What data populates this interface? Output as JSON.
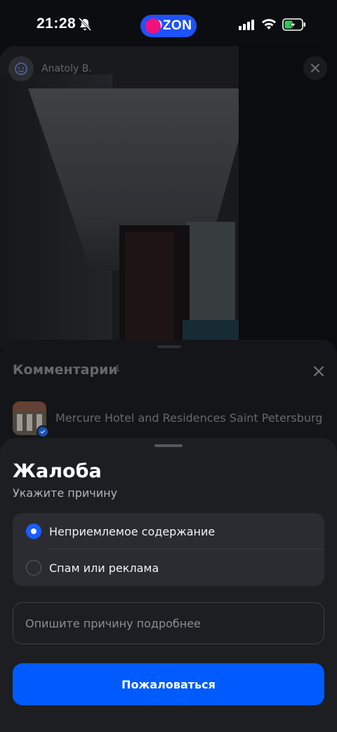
{
  "status_bar": {
    "time": "21:28",
    "app_badge": "OZON",
    "battery_state": "charging",
    "accent": "#1d52ff"
  },
  "photo": {
    "author_name": "Anatoly B."
  },
  "comments": {
    "title": "Комментарии",
    "count": "1",
    "hotel_name": "Mercure Hotel and Residences Saint Petersburg"
  },
  "complaint": {
    "title": "Жалоба",
    "subtitle": "Укажите причину",
    "options": [
      {
        "label": "Неприемлемое содержание",
        "selected": true
      },
      {
        "label": "Спам или реклама",
        "selected": false
      }
    ],
    "details_placeholder": "Опишите причину подробнее",
    "details_value": "",
    "submit_label": "Пожаловаться",
    "submit_color": "#005bff"
  }
}
